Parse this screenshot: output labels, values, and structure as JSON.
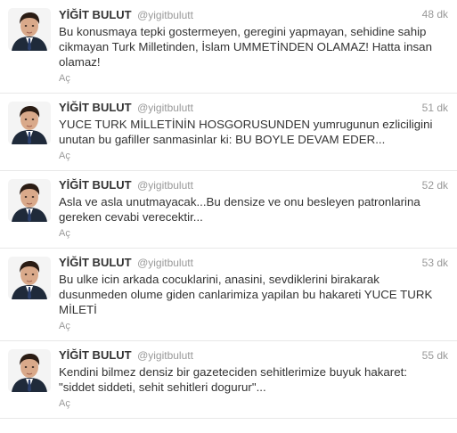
{
  "tweets": [
    {
      "name": "YİĞİT BULUT",
      "handle": "@yigitbulutt",
      "time": "48 dk",
      "text": "Bu konusmaya tepki gostermeyen, geregini yapmayan, sehidine sahip cikmayan Turk Milletinden, İslam UMMETİNDEN OLAMAZ! Hatta insan olamaz!",
      "action": "Aç"
    },
    {
      "name": "YİĞİT BULUT",
      "handle": "@yigitbulutt",
      "time": "51 dk",
      "text": "YUCE TURK MİLLETİNİN HOSGORUSUNDEN yumrugunun ezliciligini unutan bu gafiller sanmasinlar ki: BU BOYLE DEVAM EDER...",
      "action": "Aç"
    },
    {
      "name": "YİĞİT BULUT",
      "handle": "@yigitbulutt",
      "time": "52 dk",
      "text": "Asla ve asla unutmayacak...Bu densize ve onu besleyen patronlarina gereken cevabi verecektir...",
      "action": "Aç"
    },
    {
      "name": "YİĞİT BULUT",
      "handle": "@yigitbulutt",
      "time": "53 dk",
      "text": "Bu ulke icin arkada cocuklarini, anasini, sevdiklerini birakarak dusunmeden olume giden canlarimiza yapilan bu hakareti YUCE TURK MİLETİ",
      "action": "Aç"
    },
    {
      "name": "YİĞİT BULUT",
      "handle": "@yigitbulutt",
      "time": "55 dk",
      "text": "Kendini bilmez densiz bir gazeteciden sehitlerimize buyuk hakaret: \"siddet siddeti, sehit sehitleri dogurur\"...",
      "action": "Aç"
    }
  ],
  "colors": {
    "text": "#333333",
    "muted": "#999999",
    "divider": "#e8e8e8"
  },
  "icons": {
    "avatar": "profile-photo-avatar"
  }
}
